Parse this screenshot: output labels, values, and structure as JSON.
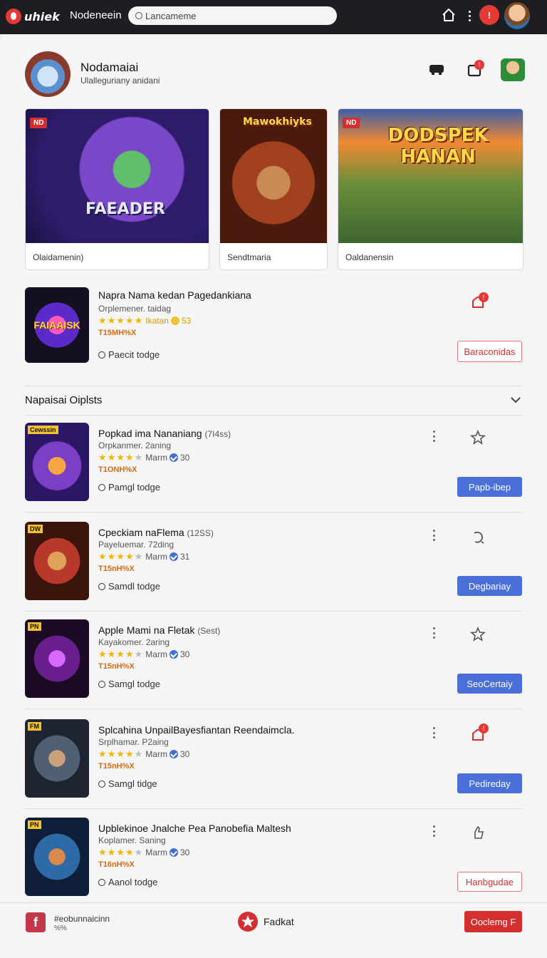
{
  "topbar": {
    "logo_text": "uhiek",
    "nav_label": "Nodeneein",
    "search_placeholder": "Lancameme",
    "notif_count": "!"
  },
  "profile": {
    "name": "Nodamaiai",
    "subtitle": "Ulalleguriany anidani",
    "badge_count": "!"
  },
  "featured": [
    {
      "tag": "ND",
      "art_title": "FAEADER",
      "caption": "Olaidamenin)"
    },
    {
      "tag": "",
      "art_title": "Mawokhiyks",
      "caption": "Sendtmaria"
    },
    {
      "tag": "ND",
      "art_title": "DODSPEK HANAN",
      "caption": "Oaldanensin"
    }
  ],
  "hero_app": {
    "title": "Napra Nama kedan Pagedankiana",
    "subtitle": "Orplemener. taidag",
    "rating_label": "Ikatan",
    "rating_count": "53",
    "price": "T15MH%X",
    "pod_label": "Paecit todge",
    "button": "Baraconidas",
    "badge": "!",
    "icon_label": "FAIAAISK"
  },
  "section": {
    "title": "Napaisai Oiplsts"
  },
  "apps": [
    {
      "title": "Popkad ima Nananiang",
      "title_note": "(7I4ss)",
      "subtitle": "Orpkanmer. 2aning",
      "rating_label": "Marm",
      "rating_count": "30",
      "price": "T1ONH%X",
      "pod_label": "Pamgl todge",
      "button": "Papb-ibep",
      "button_style": "blue",
      "action_icon": "star-outline-icon",
      "icon_label": "Cewssin"
    },
    {
      "title": "Cpeckiam naFlema",
      "title_note": "(12SS)",
      "subtitle": "Payeluemar. 72ding",
      "rating_label": "Marm",
      "rating_count": "31",
      "price": "T15nH%X",
      "pod_label": "Samdl todge",
      "button": "Degbariay",
      "button_style": "blue",
      "action_icon": "refresh-icon",
      "icon_label": "DW"
    },
    {
      "title": "Apple Mami na Fletak",
      "title_note": "(Sest)",
      "subtitle": "Kayakomer. 2aring",
      "rating_label": "Marm",
      "rating_count": "30",
      "price": "T15nH%X",
      "pod_label": "Samgl todge",
      "button": "SeoCertaiy",
      "button_style": "blue",
      "action_icon": "star-outline-icon",
      "icon_label": "PN"
    },
    {
      "title": "Splcahina UnpailBayesfiantan Reendaimcla.",
      "title_note": "",
      "subtitle": "Srplhamar. P2aing",
      "rating_label": "Marm",
      "rating_count": "30",
      "price": "T15nH%X",
      "pod_label": "Samgl tidge",
      "button": "Pedireday",
      "button_style": "blue",
      "action_icon": "notify-icon",
      "icon_label": "FM"
    },
    {
      "title": "Upblekinoe Jnalche Pea Panobefia Maltesh",
      "title_note": "",
      "subtitle": "Koplamer. Saning",
      "rating_label": "Marm",
      "rating_count": "30",
      "price": "T16nH%X",
      "pod_label": "Aanol todge",
      "button": "Hanbgudae",
      "button_style": "outline",
      "action_icon": "thumb-icon",
      "icon_label": "PN"
    }
  ],
  "footer": {
    "icon_letter": "f",
    "title": "#eobunnaicinn",
    "subtitle": "%%",
    "label": "Fadkat",
    "button": "Ooclemg F"
  },
  "colors": {
    "accent_red": "#d32f2f",
    "accent_blue": "#4a6fd8",
    "topbar": "#1d1d22",
    "star": "#f4b400"
  }
}
